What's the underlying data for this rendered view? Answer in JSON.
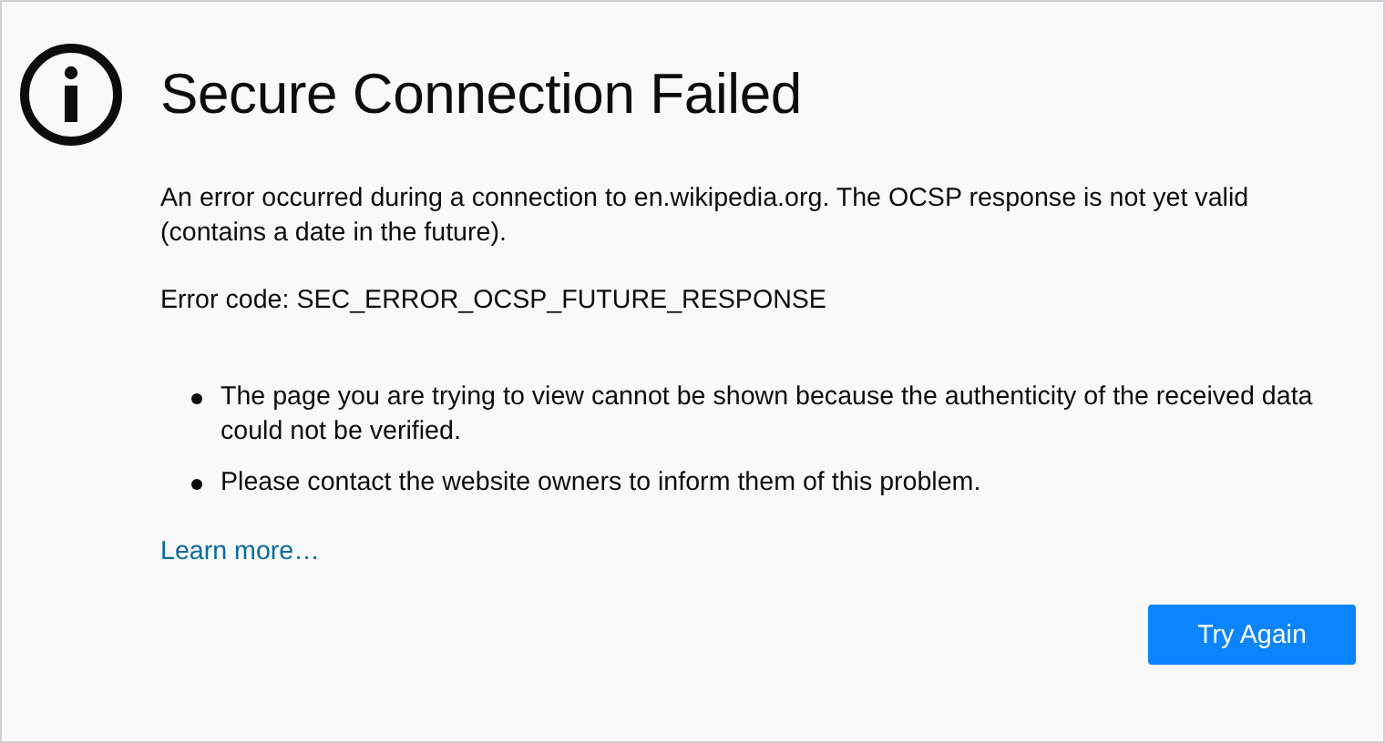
{
  "title": "Secure Connection Failed",
  "description": "An error occurred during a connection to en.wikipedia.org. The OCSP response is not yet valid (contains a date in the future).",
  "error_code": "Error code: SEC_ERROR_OCSP_FUTURE_RESPONSE",
  "details": [
    "The page you are trying to view cannot be shown because the authenticity of the received data could not be verified.",
    "Please contact the website owners to inform them of this problem."
  ],
  "learn_more": "Learn more…",
  "buttons": [
    "Try Again"
  ]
}
